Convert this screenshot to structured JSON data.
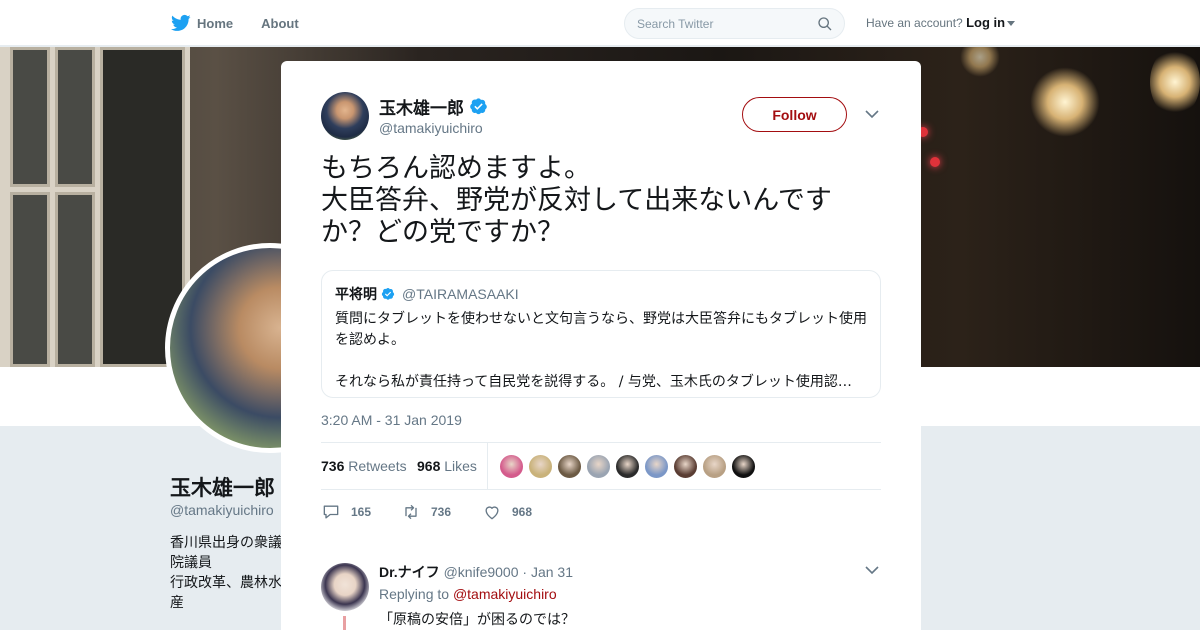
{
  "colors": {
    "accent": "#a30d10",
    "verified": "#1da1f2",
    "muted": "#657786",
    "text": "#14171a",
    "twitter_blue": "#1da1f2"
  },
  "nav": {
    "home_label": "Home",
    "about_label": "About",
    "search_placeholder": "Search Twitter",
    "have_account": "Have an account?",
    "login_label": "Log in"
  },
  "background_profile": {
    "name": "玉木雄一郎",
    "handle": "@tamakiyuichiro",
    "bio": "香川県出身の衆議院議員\n行政改革、農林水産\nはカラオケ。さぬ\n食が好物。"
  },
  "tweet": {
    "author_name": "玉木雄一郎",
    "author_handle": "@tamakiyuichiro",
    "follow_label": "Follow",
    "text": "もちろん認めますよ。\n大臣答弁、野党が反対して出来ないんです\nか？どの党ですか？",
    "quote": {
      "name": "平将明",
      "handle": "@TAIRAMASAAKI",
      "body": "質問にタブレットを使わせないと文句言うなら、野党は大臣答弁にもタブレット使用を認めよ。\n\nそれなら私が責任持って自民党を説得する。 / 与党、玉木氏のタブレット使用認…"
    },
    "timestamp": "3:20 AM - 31 Jan 2019",
    "retweets_count": "736",
    "retweets_label": "Retweets",
    "likes_count": "968",
    "likes_label": "Likes",
    "replies_action": "165",
    "retweets_action": "736",
    "likes_action": "968",
    "liker_colors": [
      "#d45b8c",
      "#c9b27a",
      "#6c5a44",
      "#9aa4b2",
      "#2b2b2b",
      "#7b97c7",
      "#5a3d33",
      "#b8a084",
      "#101010"
    ]
  },
  "reply": {
    "name": "Dr.ナイフ",
    "handle": "@knife9000",
    "date": "· Jan 31",
    "replying_prefix": "Replying to",
    "replying_to": "@tamakiyuichiro",
    "text": "「原稿の安倍」が困るのでは？"
  }
}
